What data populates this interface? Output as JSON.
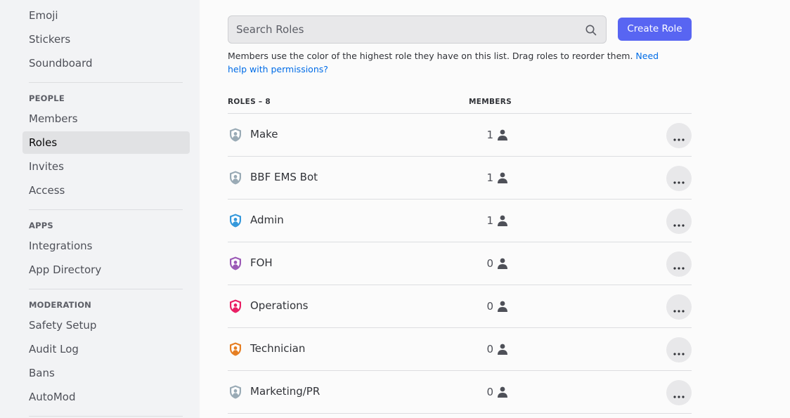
{
  "sidebar": {
    "top_items": [
      {
        "label": "Emoji"
      },
      {
        "label": "Stickers"
      },
      {
        "label": "Soundboard"
      }
    ],
    "sections": [
      {
        "header": "PEOPLE",
        "items": [
          {
            "label": "Members"
          },
          {
            "label": "Roles",
            "active": true
          },
          {
            "label": "Invites"
          },
          {
            "label": "Access"
          }
        ]
      },
      {
        "header": "APPS",
        "items": [
          {
            "label": "Integrations"
          },
          {
            "label": "App Directory"
          }
        ]
      },
      {
        "header": "MODERATION",
        "items": [
          {
            "label": "Safety Setup"
          },
          {
            "label": "Audit Log"
          },
          {
            "label": "Bans"
          },
          {
            "label": "AutoMod"
          }
        ]
      }
    ]
  },
  "search": {
    "placeholder": "Search Roles",
    "value": "",
    "icon": "search-icon"
  },
  "create_button": {
    "label": "Create Role",
    "color": "#5865f2"
  },
  "description": {
    "text": "Members use the color of the highest role they have on this list. Drag roles to reorder them.",
    "link": "Need help with permissions?",
    "link_color": "#006ce7"
  },
  "table": {
    "columns": {
      "roles": "ROLES – 8",
      "members": "MEMBERS"
    },
    "rows": [
      {
        "name": "Make",
        "members": "1",
        "color": "#99aab5"
      },
      {
        "name": "BBF EMS Bot",
        "members": "1",
        "color": "#99aab5"
      },
      {
        "name": "Admin",
        "members": "1",
        "color": "#3498db"
      },
      {
        "name": "FOH",
        "members": "0",
        "color": "#9b59b6"
      },
      {
        "name": "Operations",
        "members": "0",
        "color": "#e91e63"
      },
      {
        "name": "Technician",
        "members": "0",
        "color": "#e67e22"
      },
      {
        "name": "Marketing/PR",
        "members": "0",
        "color": "#99aab5"
      }
    ]
  }
}
